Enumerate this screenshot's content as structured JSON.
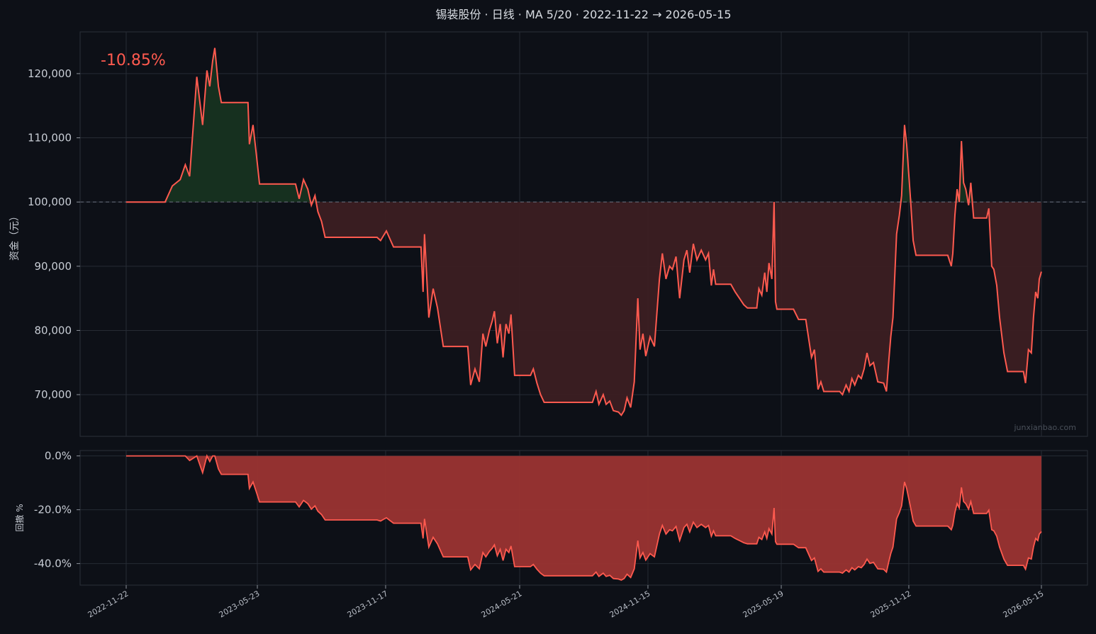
{
  "chart_data": [
    {
      "type": "area",
      "title": "锡装股份 · 日线 · MA 5/20 · 2022-11-22 → 2026-05-15",
      "ylabel": "资金（元）",
      "return_label": "-10.85%",
      "watermark": "junxianbao.com",
      "baseline": 100000,
      "ylim": [
        63500,
        126500
      ],
      "yticks": [
        70000,
        80000,
        90000,
        100000,
        110000,
        120000
      ],
      "ytick_labels": [
        "70,000",
        "80,000",
        "90,000",
        "100,000",
        "110,000",
        "120,000"
      ],
      "xticks": [
        "2022-11-22",
        "2023-05-23",
        "2023-11-17",
        "2024-05-21",
        "2024-11-15",
        "2025-05-19",
        "2025-11-12",
        "2026-05-15"
      ],
      "x_start": "2022-11-22",
      "x_end": "2026-05-15",
      "grid": true,
      "colors": {
        "line": "#ff5a4f",
        "gain_fill": "#16301f",
        "loss_fill": "#3c1f22",
        "baseline": "#6b7280"
      },
      "series": [
        {
          "values": [
            [
              "2022-11-22",
              100000
            ],
            [
              "2023-01-15",
              100000
            ],
            [
              "2023-01-25",
              102500
            ],
            [
              "2023-02-05",
              103500
            ],
            [
              "2023-02-12",
              105800
            ],
            [
              "2023-02-18",
              104000
            ],
            [
              "2023-02-28",
              119500
            ],
            [
              "2023-03-08",
              112000
            ],
            [
              "2023-03-14",
              120500
            ],
            [
              "2023-03-18",
              118000
            ],
            [
              "2023-03-22",
              122000
            ],
            [
              "2023-03-25",
              124000
            ],
            [
              "2023-03-30",
              118000
            ],
            [
              "2023-04-03",
              115500
            ],
            [
              "2023-04-10",
              115500
            ],
            [
              "2023-05-10",
              115500
            ],
            [
              "2023-05-12",
              109000
            ],
            [
              "2023-05-17",
              112000
            ],
            [
              "2023-05-22",
              107000
            ],
            [
              "2023-05-26",
              102800
            ],
            [
              "2023-06-05",
              102800
            ],
            [
              "2023-07-15",
              102800
            ],
            [
              "2023-07-20",
              100500
            ],
            [
              "2023-07-26",
              103500
            ],
            [
              "2023-08-01",
              102000
            ],
            [
              "2023-08-06",
              99500
            ],
            [
              "2023-08-11",
              101000
            ],
            [
              "2023-08-15",
              98500
            ],
            [
              "2023-08-20",
              97000
            ],
            [
              "2023-08-25",
              94500
            ],
            [
              "2023-10-01",
              94500
            ],
            [
              "2023-11-05",
              94500
            ],
            [
              "2023-11-10",
              94000
            ],
            [
              "2023-11-18",
              95500
            ],
            [
              "2023-11-28",
              93000
            ],
            [
              "2023-12-10",
              93000
            ],
            [
              "2024-01-05",
              93000
            ],
            [
              "2024-01-08",
              86000
            ],
            [
              "2024-01-10",
              95000
            ],
            [
              "2024-01-16",
              82000
            ],
            [
              "2024-01-22",
              86500
            ],
            [
              "2024-01-28",
              83500
            ],
            [
              "2024-02-05",
              77500
            ],
            [
              "2024-03-10",
              77500
            ],
            [
              "2024-03-14",
              71500
            ],
            [
              "2024-03-20",
              74000
            ],
            [
              "2024-03-26",
              72000
            ],
            [
              "2024-03-31",
              79500
            ],
            [
              "2024-04-04",
              77500
            ],
            [
              "2024-04-09",
              80000
            ],
            [
              "2024-04-13",
              81500
            ],
            [
              "2024-04-16",
              83000
            ],
            [
              "2024-04-20",
              78000
            ],
            [
              "2024-04-24",
              81000
            ],
            [
              "2024-04-28",
              75800
            ],
            [
              "2024-05-02",
              81000
            ],
            [
              "2024-05-06",
              79500
            ],
            [
              "2024-05-09",
              82500
            ],
            [
              "2024-05-14",
              73000
            ],
            [
              "2024-06-05",
              73000
            ],
            [
              "2024-06-09",
              74000
            ],
            [
              "2024-06-14",
              71800
            ],
            [
              "2024-06-19",
              70000
            ],
            [
              "2024-06-24",
              68800
            ],
            [
              "2024-08-30",
              68800
            ],
            [
              "2024-09-04",
              70500
            ],
            [
              "2024-09-08",
              68500
            ],
            [
              "2024-09-14",
              70000
            ],
            [
              "2024-09-18",
              68500
            ],
            [
              "2024-09-23",
              69000
            ],
            [
              "2024-09-28",
              67500
            ],
            [
              "2024-10-05",
              67300
            ],
            [
              "2024-10-09",
              66800
            ],
            [
              "2024-10-13",
              67500
            ],
            [
              "2024-10-17",
              69500
            ],
            [
              "2024-10-22",
              68000
            ],
            [
              "2024-10-27",
              72000
            ],
            [
              "2024-11-01",
              85000
            ],
            [
              "2024-11-04",
              77000
            ],
            [
              "2024-11-08",
              79500
            ],
            [
              "2024-11-12",
              76000
            ],
            [
              "2024-11-18",
              79000
            ],
            [
              "2024-11-24",
              77500
            ],
            [
              "2024-12-01",
              88000
            ],
            [
              "2024-12-05",
              92000
            ],
            [
              "2024-12-10",
              88000
            ],
            [
              "2024-12-15",
              90000
            ],
            [
              "2024-12-19",
              89500
            ],
            [
              "2024-12-24",
              91500
            ],
            [
              "2024-12-29",
              85000
            ],
            [
              "2025-01-04",
              91000
            ],
            [
              "2025-01-08",
              92500
            ],
            [
              "2025-01-12",
              89000
            ],
            [
              "2025-01-17",
              93500
            ],
            [
              "2025-01-22",
              91000
            ],
            [
              "2025-01-28",
              92500
            ],
            [
              "2025-02-03",
              91000
            ],
            [
              "2025-02-07",
              92000
            ],
            [
              "2025-02-11",
              87000
            ],
            [
              "2025-02-14",
              89500
            ],
            [
              "2025-02-17",
              87200
            ],
            [
              "2025-03-10",
              87200
            ],
            [
              "2025-03-16",
              86000
            ],
            [
              "2025-03-22",
              85000
            ],
            [
              "2025-03-28",
              84000
            ],
            [
              "2025-04-02",
              83500
            ],
            [
              "2025-04-15",
              83500
            ],
            [
              "2025-04-18",
              86500
            ],
            [
              "2025-04-22",
              85500
            ],
            [
              "2025-04-26",
              89000
            ],
            [
              "2025-04-29",
              86000
            ],
            [
              "2025-05-02",
              90500
            ],
            [
              "2025-05-06",
              88000
            ],
            [
              "2025-05-09",
              100000
            ],
            [
              "2025-05-11",
              84500
            ],
            [
              "2025-05-13",
              83300
            ],
            [
              "2025-06-05",
              83300
            ],
            [
              "2025-06-12",
              81700
            ],
            [
              "2025-06-22",
              81700
            ],
            [
              "2025-06-30",
              75800
            ],
            [
              "2025-07-04",
              77000
            ],
            [
              "2025-07-09",
              70800
            ],
            [
              "2025-07-13",
              72000
            ],
            [
              "2025-07-17",
              70500
            ],
            [
              "2025-08-08",
              70500
            ],
            [
              "2025-08-12",
              70000
            ],
            [
              "2025-08-17",
              71500
            ],
            [
              "2025-08-21",
              70500
            ],
            [
              "2025-08-25",
              72500
            ],
            [
              "2025-08-29",
              71500
            ],
            [
              "2025-09-03",
              73000
            ],
            [
              "2025-09-07",
              72500
            ],
            [
              "2025-09-11",
              74000
            ],
            [
              "2025-09-15",
              76500
            ],
            [
              "2025-09-19",
              74500
            ],
            [
              "2025-09-24",
              75000
            ],
            [
              "2025-09-30",
              72000
            ],
            [
              "2025-10-08",
              71800
            ],
            [
              "2025-10-12",
              70500
            ],
            [
              "2025-10-15",
              75000
            ],
            [
              "2025-10-18",
              79000
            ],
            [
              "2025-10-21",
              82000
            ],
            [
              "2025-10-26",
              95000
            ],
            [
              "2025-10-30",
              98000
            ],
            [
              "2025-11-02",
              101000
            ],
            [
              "2025-11-06",
              112000
            ],
            [
              "2025-11-09",
              109000
            ],
            [
              "2025-11-14",
              101000
            ],
            [
              "2025-11-18",
              94000
            ],
            [
              "2025-11-22",
              91700
            ],
            [
              "2026-01-05",
              91700
            ],
            [
              "2026-01-10",
              90000
            ],
            [
              "2026-01-12",
              92000
            ],
            [
              "2026-01-15",
              98000
            ],
            [
              "2026-01-18",
              102000
            ],
            [
              "2026-01-21",
              100000
            ],
            [
              "2026-01-24",
              109500
            ],
            [
              "2026-01-27",
              103000
            ],
            [
              "2026-01-30",
              102000
            ],
            [
              "2026-02-03",
              99500
            ],
            [
              "2026-02-06",
              103000
            ],
            [
              "2026-02-10",
              97500
            ],
            [
              "2026-02-28",
              97500
            ],
            [
              "2026-03-03",
              99000
            ],
            [
              "2026-03-07",
              90000
            ],
            [
              "2026-03-10",
              89500
            ],
            [
              "2026-03-14",
              87000
            ],
            [
              "2026-03-18",
              82000
            ],
            [
              "2026-03-24",
              76500
            ],
            [
              "2026-03-29",
              73600
            ],
            [
              "2026-04-20",
              73600
            ],
            [
              "2026-04-23",
              71800
            ],
            [
              "2026-04-27",
              77000
            ],
            [
              "2026-05-01",
              76500
            ],
            [
              "2026-05-04",
              82000
            ],
            [
              "2026-05-07",
              86000
            ],
            [
              "2026-05-10",
              85000
            ],
            [
              "2026-05-12",
              88000
            ],
            [
              "2026-05-15",
              89150
            ]
          ]
        }
      ]
    },
    {
      "type": "area",
      "ylabel": "回撤 %",
      "ylim": [
        -48,
        2
      ],
      "yticks": [
        0,
        -20,
        -40
      ],
      "ytick_labels": [
        "0.0%",
        "-20.0%",
        "-40.0%"
      ],
      "derived_from": "drawdown of series above",
      "colors": {
        "line": "#ff5a4f",
        "fill": "#9b3432"
      }
    }
  ]
}
